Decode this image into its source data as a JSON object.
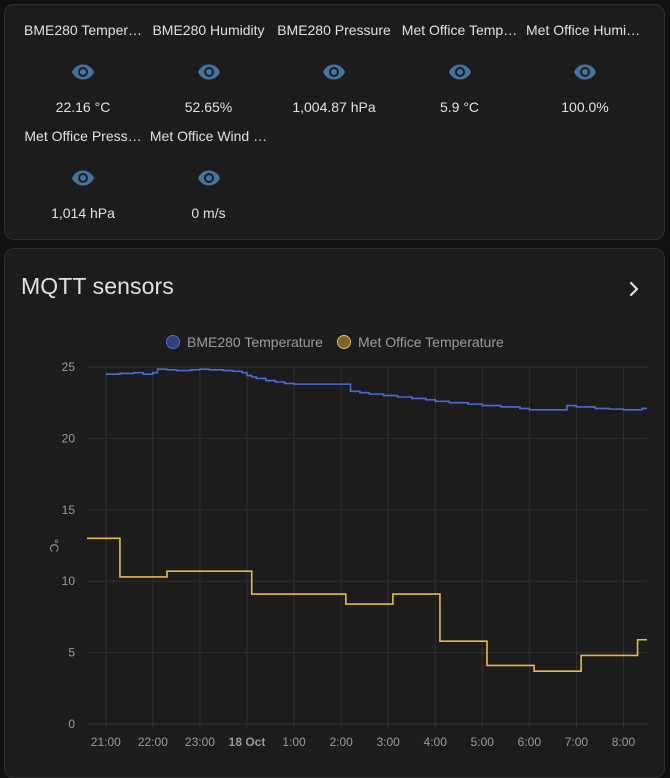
{
  "glance": {
    "entities": [
      {
        "name": "BME280 Temper…",
        "state": "22.16 °C",
        "icon": "eye-icon"
      },
      {
        "name": "BME280 Humidity",
        "state": "52.65%",
        "icon": "eye-icon"
      },
      {
        "name": "BME280 Pressure",
        "state": "1,004.87 hPa",
        "icon": "eye-icon"
      },
      {
        "name": "Met Office Temp…",
        "state": "5.9 °C",
        "icon": "eye-icon"
      },
      {
        "name": "Met Office Humid…",
        "state": "100.0%",
        "icon": "eye-icon"
      },
      {
        "name": "Met Office Press…",
        "state": "1,014 hPa",
        "icon": "eye-icon"
      },
      {
        "name": "Met Office Wind …",
        "state": "0 m/s",
        "icon": "eye-icon"
      }
    ]
  },
  "history": {
    "title": "MQTT sensors",
    "chevron_icon": "chevron-right-icon"
  },
  "colors": {
    "icon": "#44739e",
    "bme_line": "#4a6ad8",
    "met_line": "#e8b84a",
    "grid": "#2f2f2f",
    "tick": "#9b9b9b"
  },
  "chart_data": {
    "type": "line",
    "ylabel": "°C",
    "ylim": [
      0,
      25
    ],
    "yticks": [
      "0",
      "5",
      "10",
      "15",
      "20",
      "25"
    ],
    "xlim": [
      20.6,
      32.5
    ],
    "xticks": [
      {
        "label": "21:00",
        "x": 21,
        "bold": false
      },
      {
        "label": "22:00",
        "x": 22,
        "bold": false
      },
      {
        "label": "23:00",
        "x": 23,
        "bold": false
      },
      {
        "label": "18 Oct",
        "x": 24,
        "bold": true
      },
      {
        "label": "1:00",
        "x": 25,
        "bold": false
      },
      {
        "label": "2:00",
        "x": 26,
        "bold": false
      },
      {
        "label": "3:00",
        "x": 27,
        "bold": false
      },
      {
        "label": "4:00",
        "x": 28,
        "bold": false
      },
      {
        "label": "5:00",
        "x": 29,
        "bold": false
      },
      {
        "label": "6:00",
        "x": 30,
        "bold": false
      },
      {
        "label": "7:00",
        "x": 31,
        "bold": false
      },
      {
        "label": "8:00",
        "x": 32,
        "bold": false
      }
    ],
    "series": [
      {
        "name": "BME280 Temperature",
        "step": true,
        "x": [
          21.0,
          21.3,
          21.6,
          21.8,
          22.0,
          22.1,
          22.3,
          22.5,
          22.8,
          23.0,
          23.2,
          23.5,
          23.7,
          23.9,
          24.0,
          24.1,
          24.2,
          24.4,
          24.6,
          24.8,
          25.0,
          25.3,
          25.6,
          26.0,
          26.2,
          26.4,
          26.6,
          26.9,
          27.2,
          27.5,
          27.8,
          28.0,
          28.3,
          28.7,
          29.0,
          29.4,
          29.8,
          30.0,
          30.3,
          30.6,
          30.8,
          31.0,
          31.4,
          31.7,
          32.0,
          32.3,
          32.4,
          32.5
        ],
        "values": [
          24.5,
          24.55,
          24.6,
          24.5,
          24.6,
          24.85,
          24.8,
          24.75,
          24.8,
          24.85,
          24.8,
          24.75,
          24.7,
          24.6,
          24.4,
          24.3,
          24.2,
          24.05,
          23.95,
          23.85,
          23.8,
          23.8,
          23.8,
          23.8,
          23.3,
          23.2,
          23.1,
          23.0,
          22.9,
          22.8,
          22.7,
          22.6,
          22.5,
          22.4,
          22.3,
          22.2,
          22.1,
          22.0,
          22.0,
          22.0,
          22.3,
          22.2,
          22.1,
          22.05,
          22.0,
          22.0,
          22.1,
          22.1
        ]
      },
      {
        "name": "Met Office Temperature",
        "step": true,
        "x": [
          20.6,
          21.3,
          22.3,
          23.3,
          24.1,
          26.1,
          27.1,
          28.1,
          29.1,
          30.1,
          31.1,
          32.3,
          32.5
        ],
        "values": [
          13.0,
          10.3,
          10.7,
          10.7,
          9.1,
          8.4,
          9.1,
          5.8,
          4.1,
          3.7,
          4.8,
          5.9,
          5.9
        ]
      }
    ]
  }
}
